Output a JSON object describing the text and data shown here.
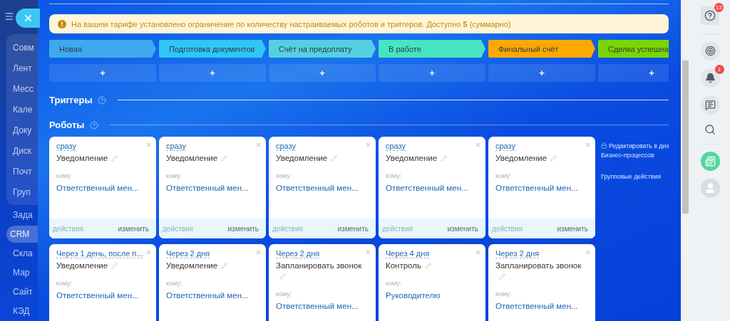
{
  "sidebar": {
    "group_items": [
      {
        "label": "Совм",
        "selected": false
      },
      {
        "label": "Лент",
        "selected": false
      },
      {
        "label": "Месс",
        "selected": false
      },
      {
        "label": "Кале",
        "selected": false
      },
      {
        "label": "Доку",
        "selected": false
      },
      {
        "label": "Диск",
        "selected": false
      },
      {
        "label": "Почт",
        "selected": false
      },
      {
        "label": "Груп",
        "selected": false
      }
    ],
    "items": [
      {
        "label": "Зада",
        "selected": false
      },
      {
        "label": "CRM",
        "selected": true
      },
      {
        "label": "Скла",
        "selected": false
      },
      {
        "label": "Мар",
        "selected": false
      },
      {
        "label": "Сайт",
        "selected": false
      },
      {
        "label": "КЭД",
        "selected": false
      }
    ]
  },
  "alert": {
    "text": "На вашем тарифе установлено ограничение по количеству настраиваемых роботов и триггеров. Доступно **5** (суммарно)"
  },
  "stages": [
    {
      "label": "Новая",
      "color": "#3ea9ef"
    },
    {
      "label": "Подготовка документов",
      "color": "#2fc7f6"
    },
    {
      "label": "Счёт на предоплату",
      "color": "#55d0e0"
    },
    {
      "label": "В работе",
      "color": "#47e4c2"
    },
    {
      "label": "Финальный счёт",
      "color": "#ffa900"
    },
    {
      "label": "Сделка успешна",
      "color": "#7bd500"
    }
  ],
  "add_buttons": [
    "+",
    "+",
    "+",
    "+",
    "+",
    "+"
  ],
  "triggers": {
    "title": "Триггеры"
  },
  "robots": {
    "title": "Роботы",
    "cards": [
      {
        "delay": "сразу",
        "title": "Уведомление",
        "to_label": "кому:",
        "recipient": "Ответственный мен...",
        "footer": {
          "actions": "действия",
          "actions_disabled": true,
          "edit": "изменить"
        }
      },
      {
        "delay": "сразу",
        "title": "Уведомление",
        "to_label": "кому:",
        "recipient": "Ответственный мен...",
        "footer": {
          "actions": "действия",
          "actions_disabled": true,
          "edit": "изменить"
        }
      },
      {
        "delay": "сразу",
        "title": "Уведомление",
        "to_label": "кому:",
        "recipient": "Ответственный мен...",
        "footer": {
          "actions": "действия",
          "actions_disabled": true,
          "edit": "изменить"
        }
      },
      {
        "delay": "сразу",
        "title": "Уведомление",
        "to_label": "кому:",
        "recipient": "Ответственный мен...",
        "footer": {
          "actions": "действия",
          "actions_disabled": true,
          "edit": "изменить"
        }
      },
      {
        "delay": "сразу",
        "title": "Уведомление",
        "to_label": "кому:",
        "recipient": "Ответственный мен...",
        "footer": {
          "actions": "действия",
          "actions_disabled": true,
          "edit": "изменить"
        }
      },
      {
        "delay": "Через 1 день, после п...",
        "title": "Уведомление",
        "to_label": "кому:",
        "recipient": "Ответственный мен..."
      },
      {
        "delay": "Через 2 дня",
        "title": "Уведомление",
        "to_label": "кому:",
        "recipient": "Ответственный мен..."
      },
      {
        "delay": "Через 2 дня",
        "title": "Запланировать звонок",
        "to_label": "кому:",
        "recipient": "Ответственный мен..."
      },
      {
        "delay": "Через 4 дня",
        "title": "Контроль",
        "to_label": "кому:",
        "recipient": "Руководителю"
      },
      {
        "delay": "Через 2 дня",
        "title": "Запланировать звонок",
        "to_label": "кому:",
        "recipient": "Ответственный мен..."
      }
    ],
    "side_links": [
      {
        "kind": "locked",
        "lines": [
          "Редактировать в диз",
          "Бизнес-процессов"
        ]
      },
      {
        "kind": "plain",
        "lines": [
          "Групповые действия"
        ]
      }
    ]
  },
  "right_bar": {
    "help_badge": "13",
    "notifications_badge": "1"
  }
}
